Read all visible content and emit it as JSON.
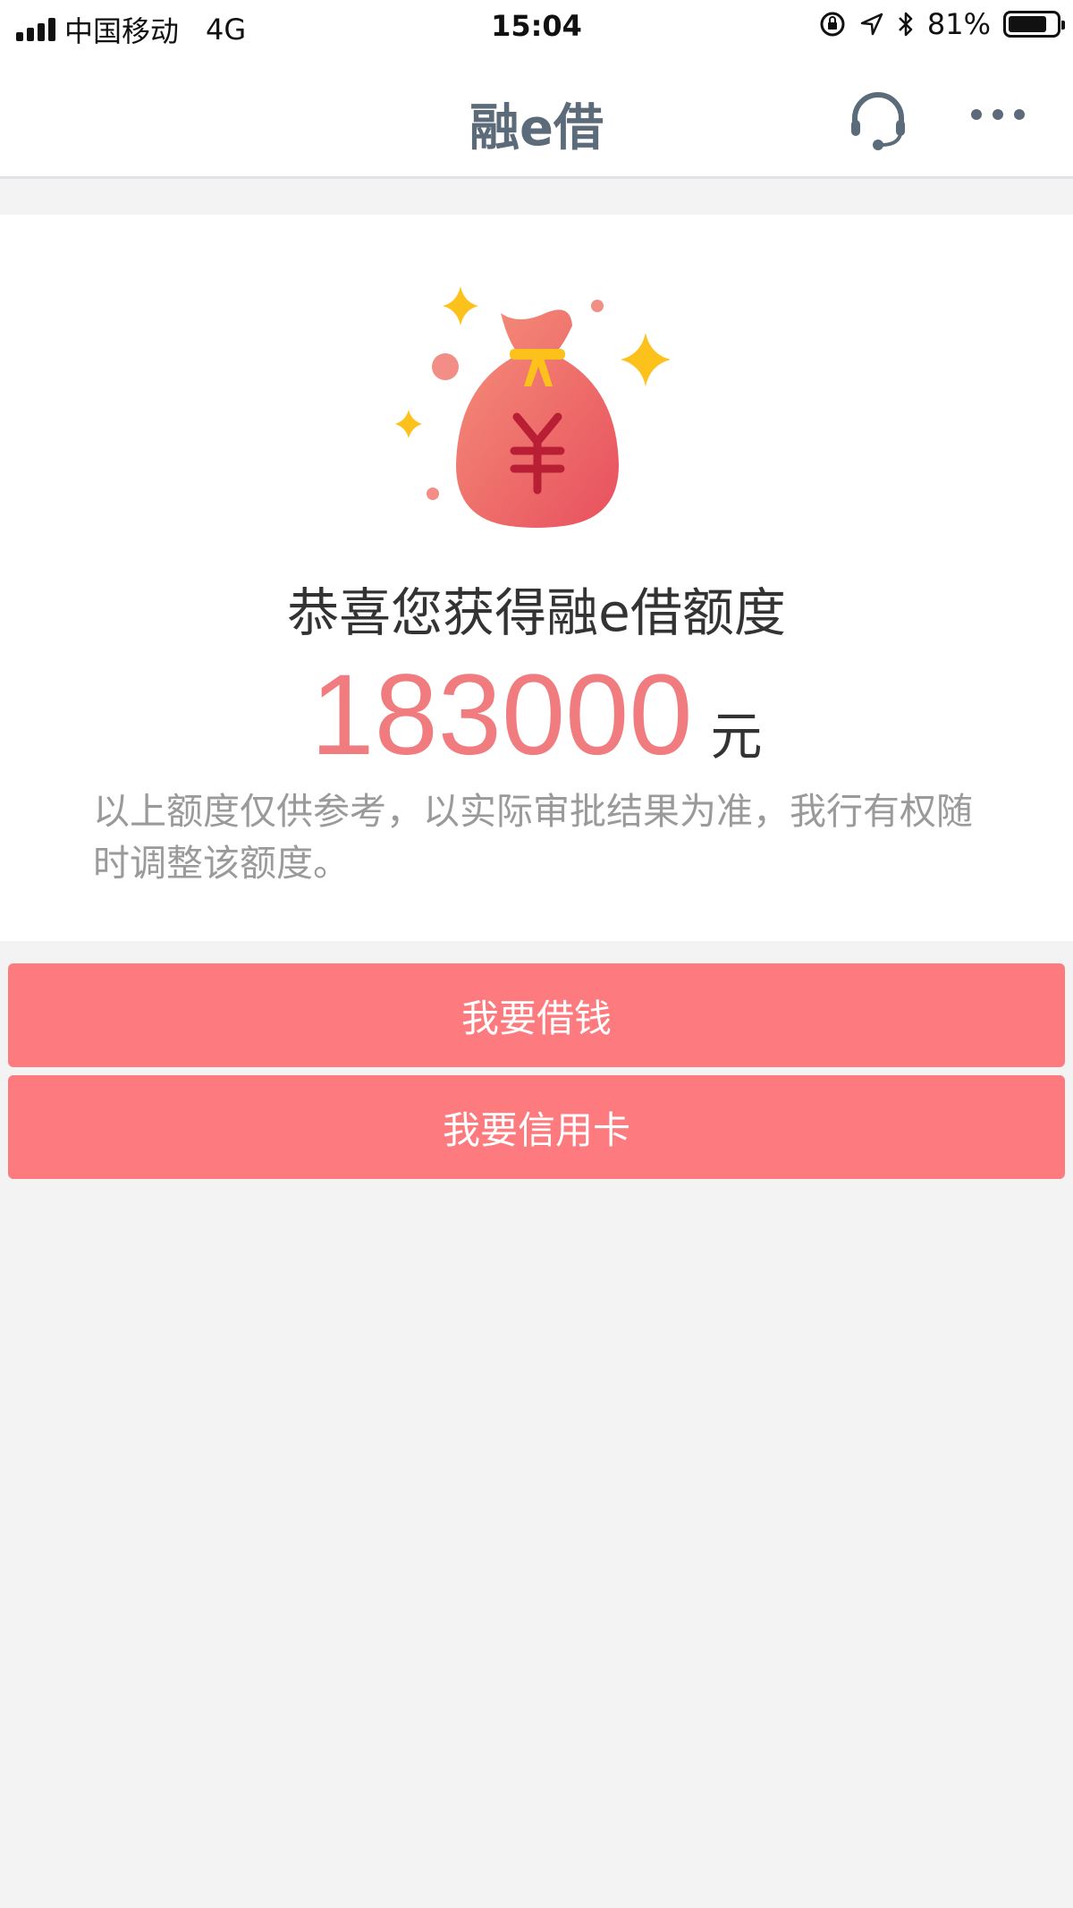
{
  "status_bar": {
    "carrier": "中国移动",
    "network": "4G",
    "time": "15:04",
    "battery_percent": "81%",
    "battery_level": 0.81
  },
  "nav": {
    "title": "融e借",
    "icons": [
      "headset-icon",
      "more-icon"
    ]
  },
  "main": {
    "illustration": "money-bag-icon",
    "congrats_text": "恭喜您获得融e借额度",
    "amount": "183000",
    "unit": "元",
    "disclaimer": "以上额度仅供参考，以实际审批结果为准，我行有权随时调整该额度。"
  },
  "actions": {
    "borrow_label": "我要借钱",
    "credit_card_label": "我要信用卡"
  },
  "colors": {
    "accent": "#fd7b7e",
    "amount": "#f07c7f",
    "nav_title": "#5b6b7a",
    "background": "#f3f3f4"
  }
}
